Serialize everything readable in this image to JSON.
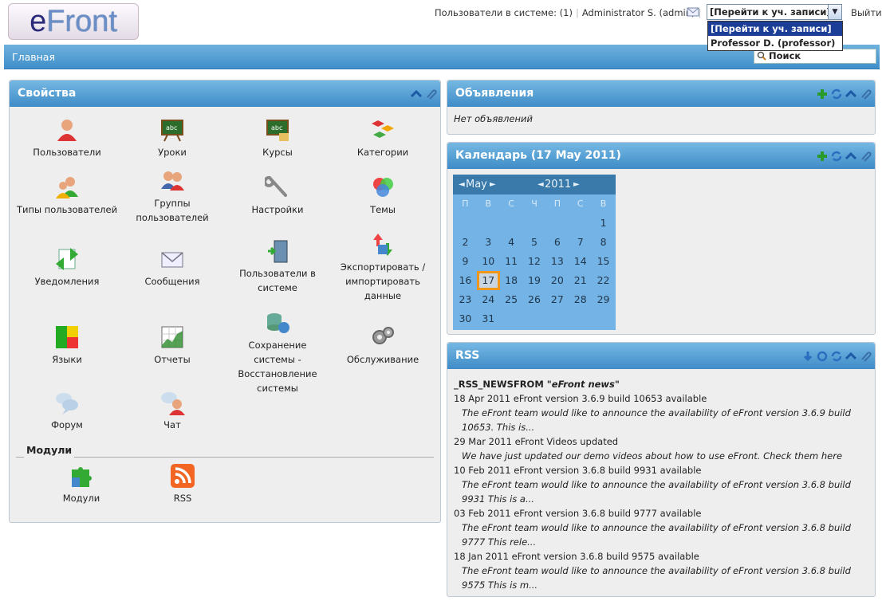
{
  "header": {
    "logo_e": "e",
    "logo_front": "Front",
    "online_label": "Пользователи в системе: (1)",
    "user": "Administrator S. (admin)",
    "account_select": "[Перейти к уч. записи]",
    "account_options": [
      "[Перейти к уч. записи]",
      "Professor D. (professor)"
    ],
    "logout": "Выйти"
  },
  "nav": {
    "home": "Главная",
    "search": "Поиск"
  },
  "properties": {
    "title": "Свойства",
    "items": [
      "Пользователи",
      "Уроки",
      "Курсы",
      "Категории",
      "Типы пользователей",
      "Группы пользователей",
      "Настройки",
      "Темы",
      "Уведомления",
      "Сообщения",
      "Пользователи в системе",
      "Экспортировать / импортировать данные",
      "Языки",
      "Отчеты",
      "Сохранение системы - Восстановление системы",
      "Обслуживание",
      "Форум",
      "Чат"
    ],
    "modules_title": "Модули",
    "modules": [
      "Модули",
      "RSS"
    ]
  },
  "announcements": {
    "title": "Объявления",
    "empty": "Нет объявлений"
  },
  "calendar": {
    "title": "Календарь (17 May 2011)",
    "month": "May",
    "year": "2011",
    "weekdays": [
      "П",
      "В",
      "С",
      "Ч",
      "П",
      "С",
      "В"
    ],
    "days": [
      "",
      "",
      "",
      "",
      "",
      "",
      "1",
      "2",
      "3",
      "4",
      "5",
      "6",
      "7",
      "8",
      "9",
      "10",
      "11",
      "12",
      "13",
      "14",
      "15",
      "16",
      "17",
      "18",
      "19",
      "20",
      "21",
      "22",
      "23",
      "24",
      "25",
      "26",
      "27",
      "28",
      "29",
      "30",
      "31",
      "",
      "",
      "",
      "",
      ""
    ],
    "today": "17"
  },
  "rss": {
    "title": "RSS",
    "source_label": "_RSS_NEWSFROM",
    "source_name": "eFront news",
    "items": [
      {
        "date": "18 Apr 2011",
        "headline": "eFront version 3.6.9 build 10653 available",
        "body": "The eFront team would like to announce the availability of eFront version 3.6.9 build 10653. This is..."
      },
      {
        "date": "29 Mar 2011",
        "headline": "eFront Videos updated",
        "body": "We have just updated our demo videos about how to use eFront. Check them here"
      },
      {
        "date": "10 Feb 2011",
        "headline": "eFront version 3.6.8 build 9931 available",
        "body": "The eFront team would like to announce the availability of eFront version 3.6.8 build 9931 This is a..."
      },
      {
        "date": "03 Feb 2011",
        "headline": "eFront version 3.6.8 build 9777 available",
        "body": "The eFront team would like to announce the availability of eFront version 3.6.8 build 9777 This rele..."
      },
      {
        "date": "18 Jan 2011",
        "headline": "eFront version 3.6.8 build 9575 available",
        "body": "The eFront team would like to announce the availability of eFront version 3.6.8 build 9575 This is m..."
      }
    ]
  }
}
